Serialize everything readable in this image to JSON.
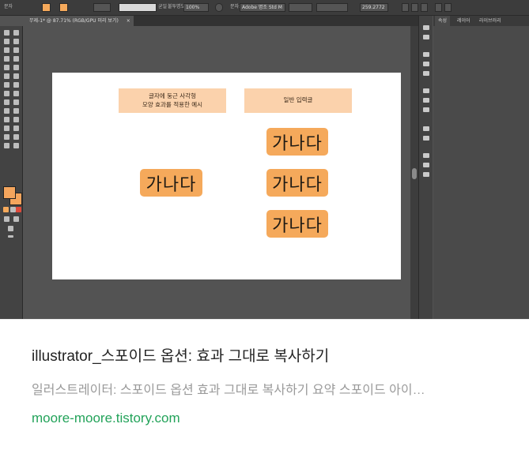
{
  "document_tab": {
    "title": "무제-1* @ 87.71% (RGB/GPU 미리 보기)",
    "close": "×"
  },
  "control_bar": {
    "width_label": "균일",
    "opacity_label": "불투명도:",
    "opacity_value": "100%",
    "font_label": "문자:",
    "font_name": "Adobe 명조 Std M",
    "size_value": "259.2772"
  },
  "right_panel": {
    "tabs": [
      "속성",
      "레이어",
      "라이브러리"
    ]
  },
  "artboard": {
    "label_left": "글자에 둥근 사각형\n모양 효과를 적용한 예시",
    "label_right": "일반 입력글",
    "sample_text": "가나다"
  },
  "caption": {
    "title": "illustrator_스포이드 옵션: 효과 그대로 복사하기",
    "description": "일러스트레이터: 스포이드 옵션 효과 그대로 복사하기 요약 스포이드 아이…",
    "source": "moore-moore.tistory.com"
  },
  "colors": {
    "orange": "#f5a95b",
    "label_bg": "#fbd2ac",
    "source_green": "#23a35a"
  }
}
